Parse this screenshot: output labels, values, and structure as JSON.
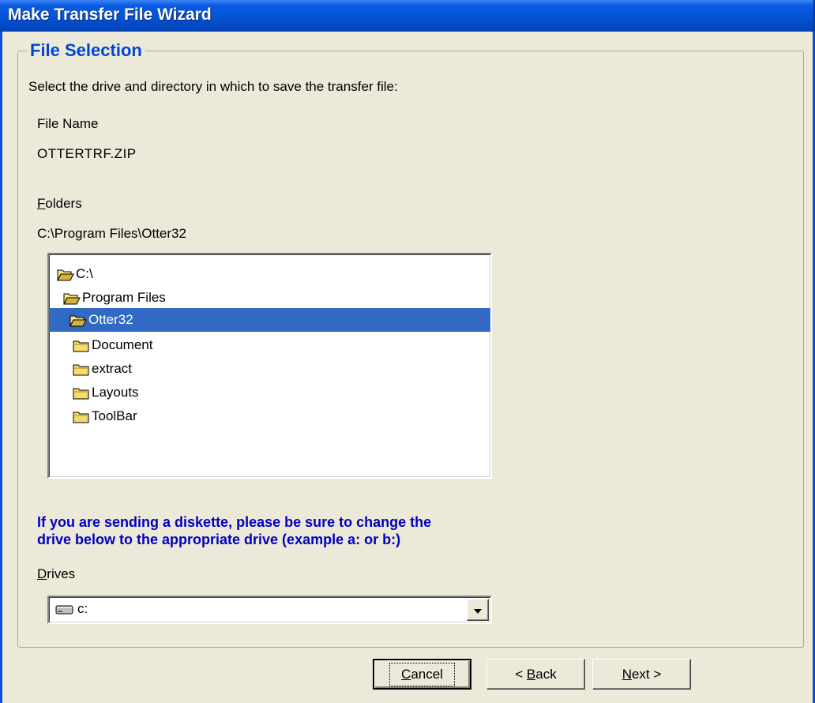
{
  "window": {
    "title": "Make Transfer File Wizard"
  },
  "group": {
    "title": "File Selection"
  },
  "instruction": "Select the drive and directory in which to save the transfer file:",
  "file_name": {
    "label": "File Name",
    "value": "OTTERTRF.ZIP"
  },
  "folders": {
    "label_accel": "F",
    "label_rest": "olders",
    "current_path": "C:\\Program Files\\Otter32",
    "items": [
      {
        "label": "C:\\",
        "state": "open",
        "selected": false
      },
      {
        "label": "Program Files",
        "state": "open",
        "selected": false
      },
      {
        "label": "Otter32",
        "state": "open",
        "selected": true
      },
      {
        "label": "Document",
        "state": "closed",
        "selected": false
      },
      {
        "label": "extract",
        "state": "closed",
        "selected": false
      },
      {
        "label": "Layouts",
        "state": "closed",
        "selected": false
      },
      {
        "label": "ToolBar",
        "state": "closed",
        "selected": false
      }
    ]
  },
  "warning": {
    "line1": "If you are sending a diskette, please be sure to change the",
    "line2": "drive below to the appropriate drive (example a: or b:)",
    "color": "#0000c0"
  },
  "drives": {
    "label_accel": "D",
    "label_rest": "rives",
    "selected": "c:",
    "icon": "hard-drive-icon"
  },
  "buttons": {
    "cancel": {
      "accel": "C",
      "rest": "ancel"
    },
    "back": {
      "prefix": "< ",
      "accel": "B",
      "rest": "ack"
    },
    "next": {
      "accel": "N",
      "rest": "ext >"
    }
  },
  "colors": {
    "titlebar": "#0553d6",
    "selection": "#316ac5",
    "group_title": "#0046d5",
    "dialog_bg": "#ece9d8"
  }
}
